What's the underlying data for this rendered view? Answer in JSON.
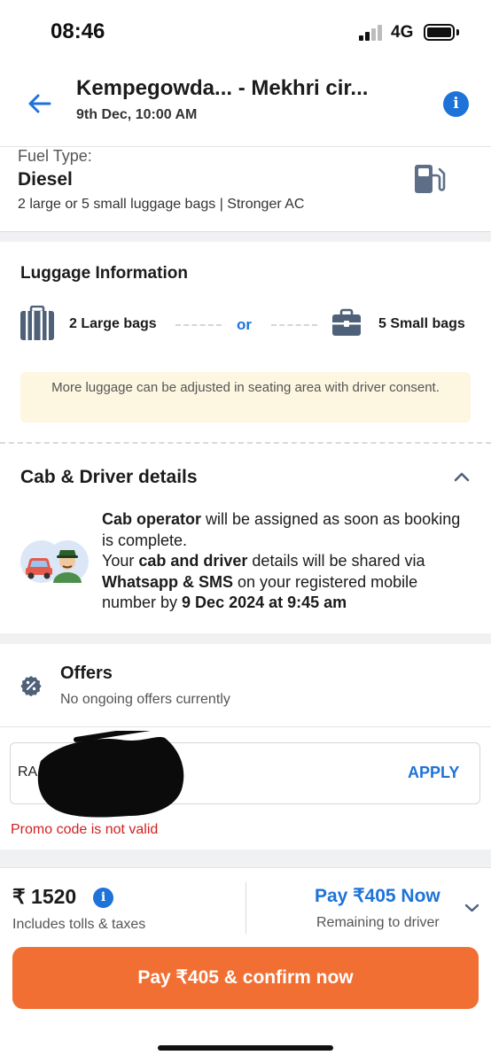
{
  "status_bar": {
    "time": "08:46",
    "network": "4G"
  },
  "header": {
    "route": "Kempegowda... - Mekhri cir...",
    "datetime": "9th Dec, 10:00 AM",
    "back_icon": "arrow-left-icon",
    "info_icon": "info-icon",
    "info_glyph": "i"
  },
  "fuel": {
    "label": "Fuel Type:",
    "value": "Diesel",
    "description": "2 large or 5 small luggage bags | Stronger AC",
    "icon": "fuel-pump-icon"
  },
  "luggage": {
    "title": "Luggage Information",
    "large": "2 Large bags",
    "or": "or",
    "small": "5 Small bags",
    "note": "More luggage can be adjusted in seating area with driver consent."
  },
  "cab_driver": {
    "title": "Cab & Driver details",
    "line1_bold": "Cab operator",
    "line1_rest": " will be assigned as soon as booking is complete.",
    "line2_start": "Your ",
    "line2_bold1": "cab and driver",
    "line2_mid": " details will be shared via ",
    "line2_bold2": "Whatsapp & SMS",
    "line2_mid2": " on your registered mobile number by ",
    "line2_bold3": "9 Dec 2024 at 9:45 am"
  },
  "offers": {
    "title": "Offers",
    "subtitle": "No ongoing offers currently",
    "promo_value": "RA                  YL",
    "apply_label": "APPLY",
    "error": "Promo code is not valid"
  },
  "footer": {
    "currency": "₹",
    "total": "₹ 1520",
    "info_glyph": "i",
    "total_note": "Includes tolls & taxes",
    "pay_now": "Pay ₹405 Now",
    "pay_note": "Remaining to driver",
    "cta_label": "Pay ₹405 & confirm now"
  },
  "colors": {
    "accent": "#1e73d9",
    "cta": "#f26f33",
    "error": "#d21f1f",
    "note_bg": "#fdf6e1"
  }
}
